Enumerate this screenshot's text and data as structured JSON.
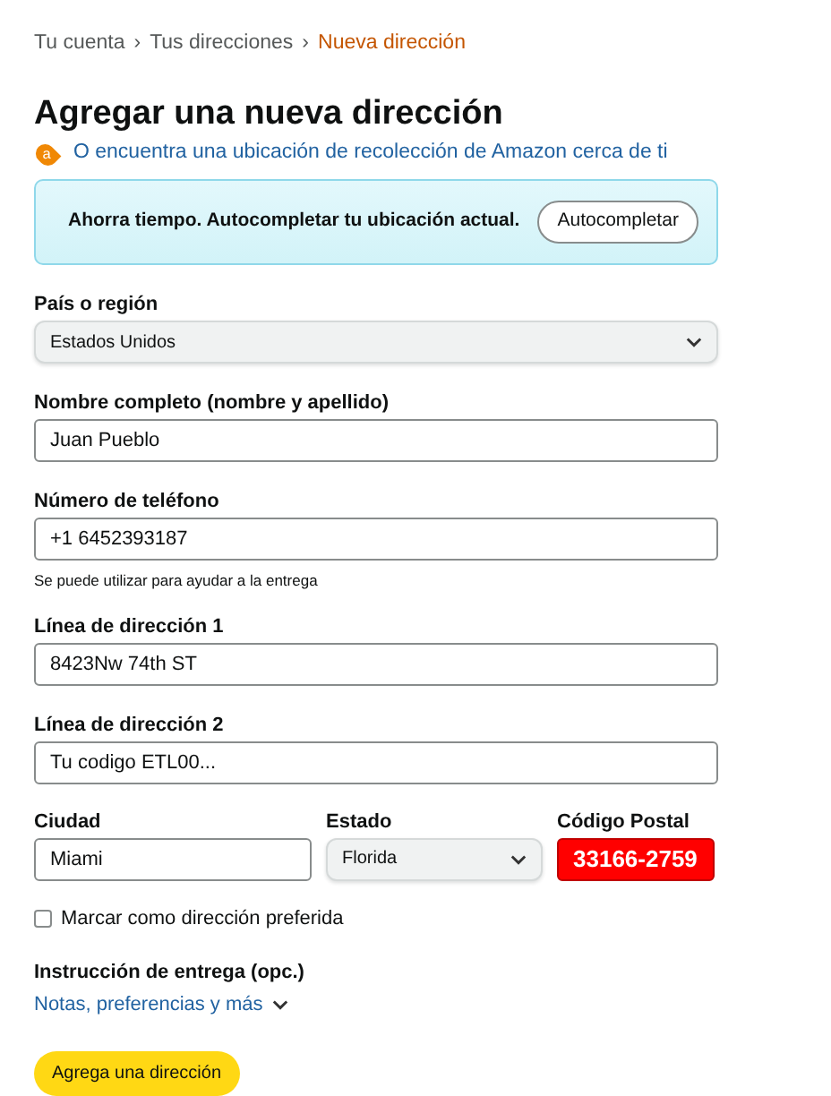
{
  "breadcrumb": [
    {
      "label": "Tu cuenta",
      "current": false
    },
    {
      "label": "Tus direcciones",
      "current": false
    },
    {
      "label": "Nueva dirección",
      "current": true
    }
  ],
  "separator": "›",
  "title": "Agregar una nueva dirección",
  "pickup_link": {
    "badge": "a",
    "text": "O encuentra una ubicación de recolección de Amazon cerca de ti"
  },
  "banner": {
    "text": "Ahorra tiempo. Autocompletar tu ubicación actual.",
    "button": "Autocompletar"
  },
  "fields": [
    {
      "kind": "select",
      "label": "País o región",
      "value": "Estados Unidos"
    },
    {
      "kind": "text",
      "label": "Nombre completo (nombre y apellido)",
      "value": "Juan Pueblo"
    },
    {
      "kind": "text",
      "label": "Número de teléfono",
      "value": "+1 6452393187",
      "hint": "Se puede utilizar para ayudar a la entrega"
    },
    {
      "kind": "text",
      "label": "Línea de dirección 1",
      "value": "8423Nw 74th ST"
    },
    {
      "kind": "text",
      "label": "Línea de dirección 2",
      "value": "Tu codigo ETL00..."
    }
  ],
  "row_fields": [
    {
      "kind": "text",
      "label": "Ciudad",
      "value": "Miami"
    },
    {
      "kind": "select",
      "label": "Estado",
      "value": "Florida"
    },
    {
      "kind": "text",
      "label": "Código Postal",
      "value": "33166-2759",
      "highlighted": true
    }
  ],
  "preferred_checkbox": {
    "label": "Marcar como dirección preferida",
    "checked": false
  },
  "delivery": {
    "label": "Instrucción de entrega (opc.)",
    "link": "Notas, preferencias y más",
    "expanded": false
  },
  "submit": "Agrega una dirección"
}
